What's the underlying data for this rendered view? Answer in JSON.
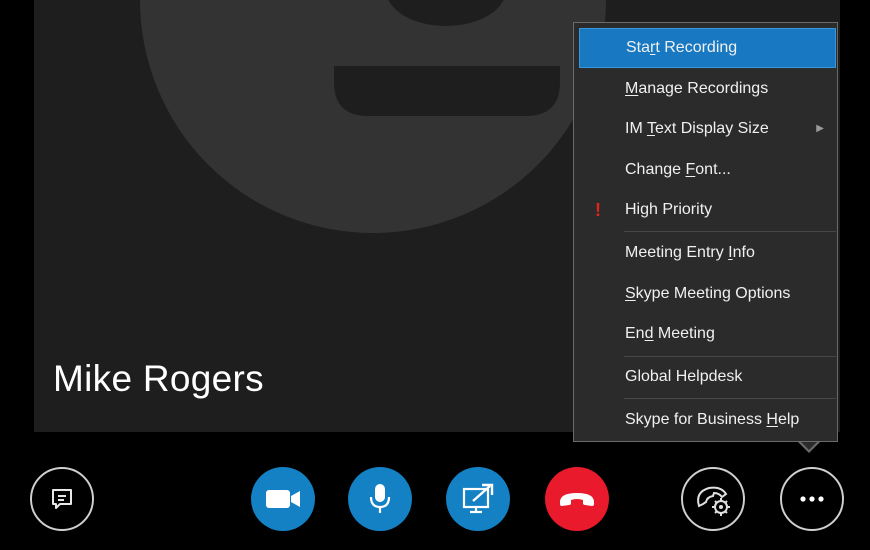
{
  "participant": {
    "name": "Mike Rogers"
  },
  "menu": {
    "items": [
      {
        "pre": "Sta",
        "ul": "r",
        "post": "t Recording"
      },
      {
        "pre": "",
        "ul": "M",
        "post": "anage Recordings"
      },
      {
        "pre": "IM ",
        "ul": "T",
        "post": "ext Display Size"
      },
      {
        "pre": "Change ",
        "ul": "F",
        "post": "ont..."
      },
      {
        "pre": "",
        "ul": "",
        "post": "High Priority"
      },
      {
        "pre": "Meeting Entry ",
        "ul": "I",
        "post": "nfo"
      },
      {
        "pre": "",
        "ul": "S",
        "post": "kype Meeting Options"
      },
      {
        "pre": "En",
        "ul": "d",
        "post": " Meeting"
      },
      {
        "pre": "",
        "ul": "",
        "post": "Global Helpdesk"
      },
      {
        "pre": "Skype for Business ",
        "ul": "H",
        "post": "elp"
      }
    ],
    "priority_mark": "!"
  },
  "controls": {
    "chat": "chat-icon",
    "video": "video-camera-icon",
    "mic": "microphone-icon",
    "share": "present-share-icon",
    "hangup": "hang-up-icon",
    "call_controls": "phone-settings-icon",
    "more": "more-options-icon"
  },
  "colors": {
    "accent_blue": "#1481c5",
    "menu_highlight": "#1879c2",
    "hangup_red": "#e81a2b",
    "priority_red": "#e2261c"
  }
}
